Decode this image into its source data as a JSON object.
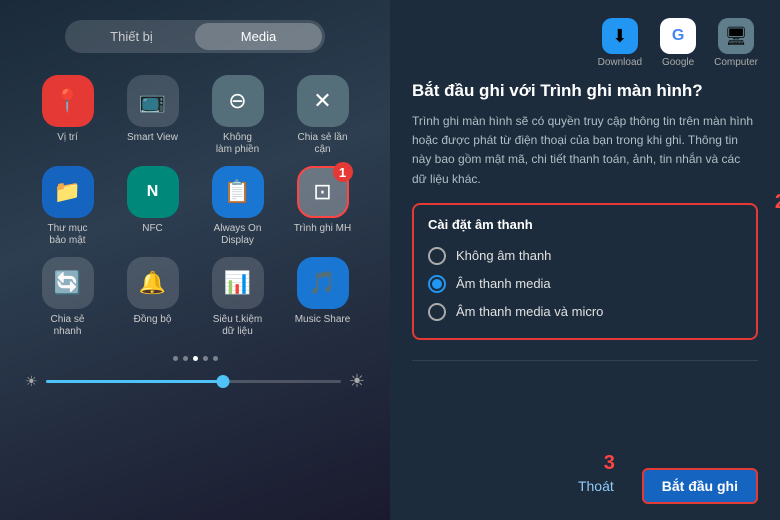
{
  "left": {
    "tabs": [
      {
        "label": "Thiết bị",
        "active": false
      },
      {
        "label": "Media",
        "active": true
      }
    ],
    "icons": [
      {
        "id": "vi-tri",
        "label": "Vị trí",
        "icon": "📍",
        "bg": "bg-red"
      },
      {
        "id": "smart-view",
        "label": "Smart View",
        "icon": "📺",
        "bg": "bg-dark"
      },
      {
        "id": "khong-lam-phien",
        "label": "Không\nlàm phiền",
        "icon": "⊖",
        "bg": "bg-gray"
      },
      {
        "id": "chia-se-lan-can",
        "label": "Chia sẻ lần\ncận",
        "icon": "✕",
        "bg": "bg-gray"
      },
      {
        "id": "thu-muc-bao-mat",
        "label": "Thư mục\nbảo mật",
        "icon": "📁",
        "bg": "bg-blue"
      },
      {
        "id": "nfc",
        "label": "NFC",
        "icon": "N",
        "bg": "bg-teal"
      },
      {
        "id": "always-on",
        "label": "Always On\nDisplay",
        "icon": "📋",
        "bg": "bg-blue2"
      },
      {
        "id": "trinh-ghi-mh",
        "label": "Trình ghi MH",
        "icon": "⊡",
        "bg": "bg-highlighted",
        "step": "1"
      },
      {
        "id": "chia-se-nhanh",
        "label": "Chia sẻ\nnhanh",
        "icon": "🔄",
        "bg": "bg-dark"
      },
      {
        "id": "dong-bo",
        "label": "Đồng bộ",
        "icon": "🔔",
        "bg": "bg-dark"
      },
      {
        "id": "sieu-tiet-kiem",
        "label": "Siêu t.kiệm\ndữ liệu",
        "icon": "📊",
        "bg": "bg-dark"
      },
      {
        "id": "music-share",
        "label": "Music Share",
        "icon": "🎵",
        "bg": "bg-blue2"
      }
    ],
    "dots": [
      false,
      false,
      true,
      false,
      false
    ],
    "brightness": 60
  },
  "right": {
    "top_apps": [
      {
        "label": "Download",
        "icon": "⬇",
        "bg": "bg-download"
      },
      {
        "label": "Google",
        "icon": "G",
        "bg": "bg-google"
      },
      {
        "label": "Computer",
        "icon": "🖥",
        "bg": "bg-computer"
      }
    ],
    "dialog": {
      "title": "Bắt đầu ghi với Trình ghi màn hình?",
      "description": "Trình ghi màn hình sẽ có quyền truy cập thông tin trên màn hình hoặc được phát từ điện thoại của bạn trong khi ghi. Thông tin này bao gồm mật mã, chi tiết thanh toán, ảnh, tin nhắn và các dữ liệu khác.",
      "audio_section_title": "Cài đặt âm thanh",
      "audio_options": [
        {
          "id": "no-audio",
          "label": "Không âm thanh",
          "selected": false
        },
        {
          "id": "media-audio",
          "label": "Âm thanh media",
          "selected": true
        },
        {
          "id": "media-micro",
          "label": "Âm thanh media và micro",
          "selected": false
        }
      ],
      "btn_exit_label": "Thoát",
      "btn_start_label": "Bắt đầu ghi",
      "step2_label": "2",
      "step3_label": "3"
    }
  }
}
